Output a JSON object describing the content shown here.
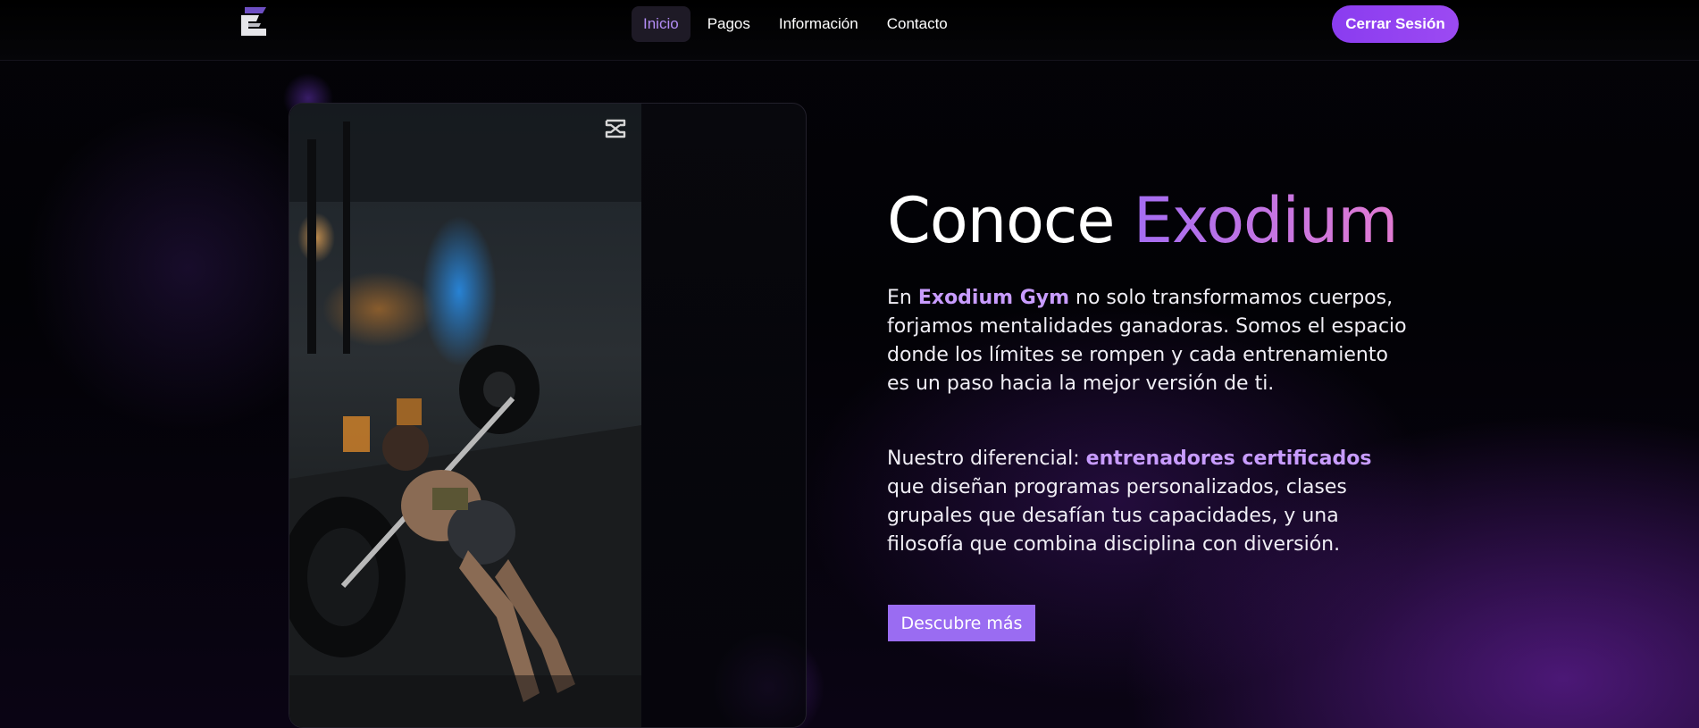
{
  "nav": {
    "logo_icon": "exodium-e-logo",
    "links": [
      {
        "label": "Inicio",
        "active": true
      },
      {
        "label": "Pagos",
        "active": false
      },
      {
        "label": "Información",
        "active": false
      },
      {
        "label": "Contacto",
        "active": false
      }
    ],
    "logout_label": "Cerrar Sesión"
  },
  "media": {
    "overlay_icon": "capcut-icon"
  },
  "hero": {
    "title_main": "Conoce ",
    "title_accent": "Exodium",
    "p1_pre": "En ",
    "p1_highlight": "Exodium Gym",
    "p1_post": " no solo transformamos cuerpos, forjamos mentalidades ganadoras. Somos el espacio donde los límites se rompen y cada entrenamiento es un paso hacia la mejor versión de ti.",
    "p2_pre": "Nuestro diferencial: ",
    "p2_highlight": "entrenadores certificados",
    "p2_post": " que diseñan programas personalizados, clases grupales que desafían tus capacidades, y una filosofía que combina disciplina con diversión.",
    "cta_label": "Descubre más"
  },
  "colors": {
    "accent": "#9a6cf2",
    "highlight": "#c89cff",
    "nav_active": "#b38df5"
  }
}
